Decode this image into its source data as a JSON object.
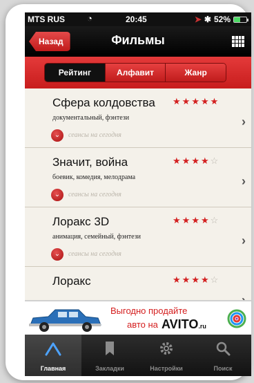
{
  "status_bar": {
    "carrier": "MTS RUS",
    "time": "20:45",
    "battery": "52%",
    "battery_level": 0.52
  },
  "nav": {
    "back_label": "Назад",
    "title": "Фильмы",
    "menu_icon": "grid-icon"
  },
  "segments": [
    {
      "label": "Рейтинг",
      "active": true
    },
    {
      "label": "Алфавит",
      "active": false
    },
    {
      "label": "Жанр",
      "active": false
    }
  ],
  "movies": [
    {
      "title": "Сфера колдовства",
      "genres": "документальный, фэнтези",
      "rating": 5,
      "max_rating": 5,
      "sessions": "сеансы на сегодня"
    },
    {
      "title": "Значит, война",
      "genres": "боевик, комедия, мелодрама",
      "rating": 4,
      "max_rating": 5,
      "sessions": "сеансы на сегодня"
    },
    {
      "title": "Лоракс 3D",
      "genres": "анимация, семейный, фэнтези",
      "rating": 4,
      "max_rating": 5,
      "sessions": "сеансы на сегодня"
    },
    {
      "title": "Лоракс",
      "genres": "",
      "rating": 4,
      "max_rating": 5,
      "sessions": ""
    }
  ],
  "banner": {
    "line1": "Выгодно продайте",
    "line2": "авто на",
    "brand": "AVITO",
    "brand_suffix": ".ru"
  },
  "tabs": [
    {
      "label": "Главная",
      "icon": "home-icon",
      "active": true
    },
    {
      "label": "Закладки",
      "icon": "bookmark-icon",
      "active": false
    },
    {
      "label": "Настройки",
      "icon": "gear-icon",
      "active": false
    },
    {
      "label": "Поиск",
      "icon": "search-icon",
      "active": false
    }
  ],
  "colors": {
    "accent_red": "#d32020",
    "nav_black": "#000000",
    "list_bg": "#f4f1ea"
  }
}
